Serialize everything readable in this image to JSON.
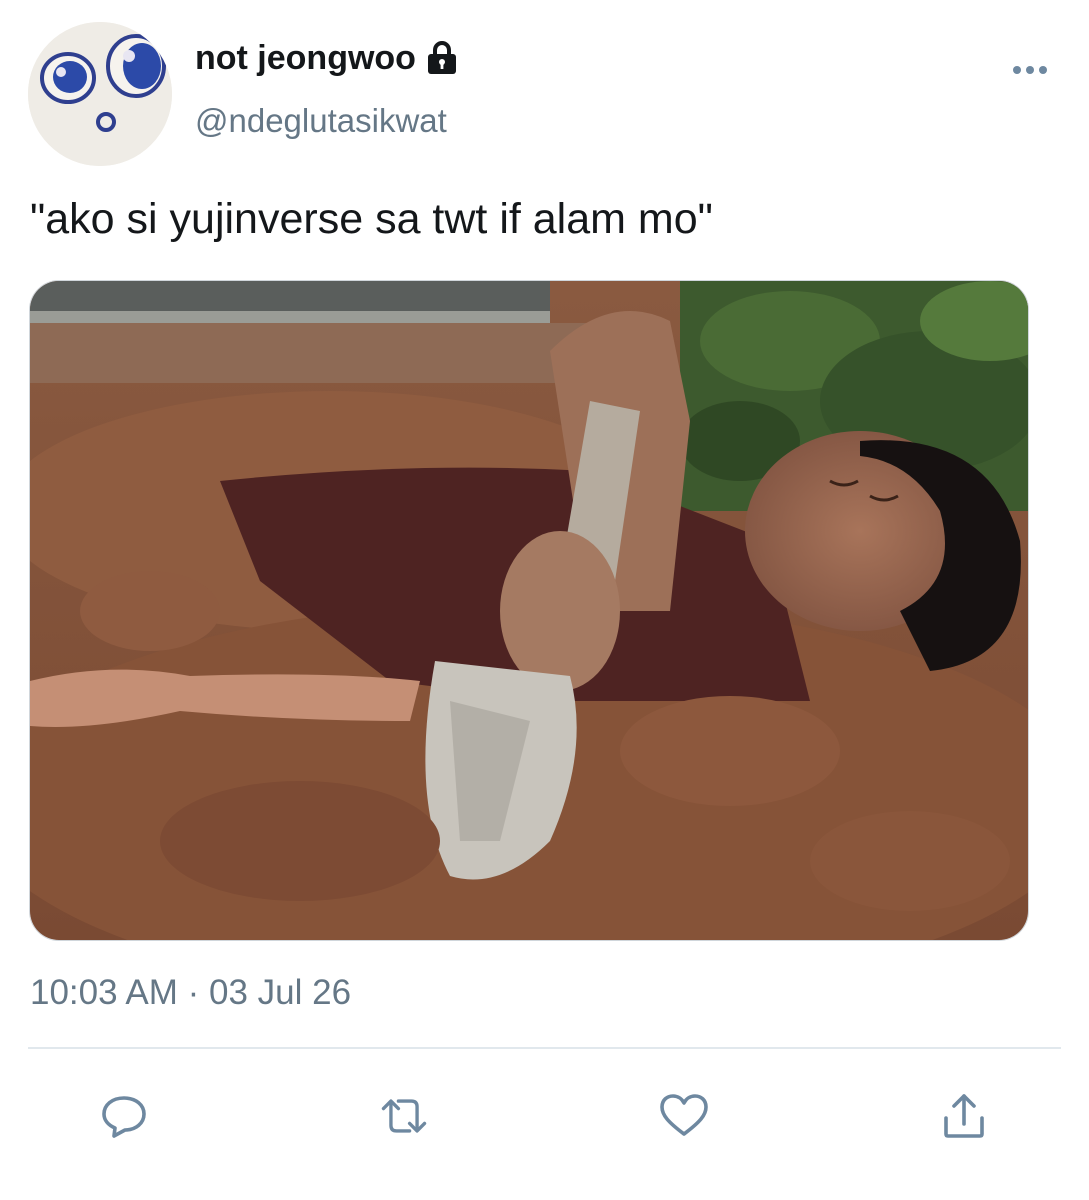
{
  "tweet": {
    "display_name": "not jeongwoo",
    "handle": "@ndeglutasikwat",
    "text": "\"ako si yujinverse sa twt if alam mo\"",
    "timestamp": "10:03 AM · 03 Jul 26",
    "protected": true
  },
  "icons": {
    "lock": "lock-icon",
    "more": "more-horizontal-icon",
    "reply": "reply-icon",
    "retweet": "retweet-icon",
    "like": "heart-icon",
    "share": "share-icon"
  },
  "colors": {
    "text": "#14171a",
    "secondary": "#657786",
    "icon": "#6e88a0",
    "divider": "#e1e8ed"
  }
}
